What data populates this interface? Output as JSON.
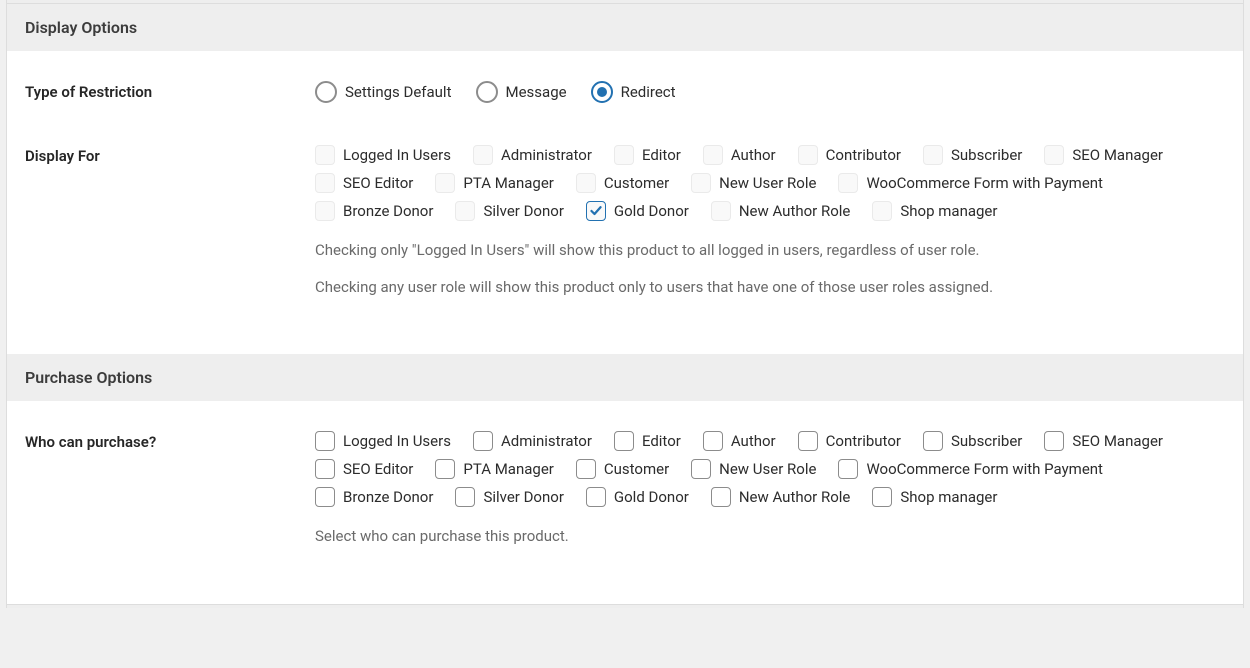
{
  "display_options": {
    "title": "Display Options",
    "restriction": {
      "label": "Type of Restriction",
      "options": [
        {
          "label": "Settings Default",
          "selected": false
        },
        {
          "label": "Message",
          "selected": false
        },
        {
          "label": "Redirect",
          "selected": true
        }
      ]
    },
    "display_for": {
      "label": "Display For",
      "checkbox_style": "light",
      "roles": [
        {
          "label": "Logged In Users",
          "checked": false
        },
        {
          "label": "Administrator",
          "checked": false
        },
        {
          "label": "Editor",
          "checked": false
        },
        {
          "label": "Author",
          "checked": false
        },
        {
          "label": "Contributor",
          "checked": false
        },
        {
          "label": "Subscriber",
          "checked": false
        },
        {
          "label": "SEO Manager",
          "checked": false
        },
        {
          "label": "SEO Editor",
          "checked": false
        },
        {
          "label": "PTA Manager",
          "checked": false
        },
        {
          "label": "Customer",
          "checked": false
        },
        {
          "label": "New User Role",
          "checked": false
        },
        {
          "label": "WooCommerce Form with Payment",
          "checked": false
        },
        {
          "label": "Bronze Donor",
          "checked": false
        },
        {
          "label": "Silver Donor",
          "checked": false
        },
        {
          "label": "Gold Donor",
          "checked": true
        },
        {
          "label": "New Author Role",
          "checked": false
        },
        {
          "label": "Shop manager",
          "checked": false
        }
      ],
      "help1": "Checking only \"Logged In Users\" will show this product to all logged in users, regardless of user role.",
      "help2": "Checking any user role will show this product only to users that have one of those user roles assigned."
    }
  },
  "purchase_options": {
    "title": "Purchase Options",
    "who_can_purchase": {
      "label": "Who can purchase?",
      "checkbox_style": "strong",
      "roles": [
        {
          "label": "Logged In Users",
          "checked": false
        },
        {
          "label": "Administrator",
          "checked": false
        },
        {
          "label": "Editor",
          "checked": false
        },
        {
          "label": "Author",
          "checked": false
        },
        {
          "label": "Contributor",
          "checked": false
        },
        {
          "label": "Subscriber",
          "checked": false
        },
        {
          "label": "SEO Manager",
          "checked": false
        },
        {
          "label": "SEO Editor",
          "checked": false
        },
        {
          "label": "PTA Manager",
          "checked": false
        },
        {
          "label": "Customer",
          "checked": false
        },
        {
          "label": "New User Role",
          "checked": false
        },
        {
          "label": "WooCommerce Form with Payment",
          "checked": false
        },
        {
          "label": "Bronze Donor",
          "checked": false
        },
        {
          "label": "Silver Donor",
          "checked": false
        },
        {
          "label": "Gold Donor",
          "checked": false
        },
        {
          "label": "New Author Role",
          "checked": false
        },
        {
          "label": "Shop manager",
          "checked": false
        }
      ],
      "help1": "Select who can purchase this product."
    }
  }
}
